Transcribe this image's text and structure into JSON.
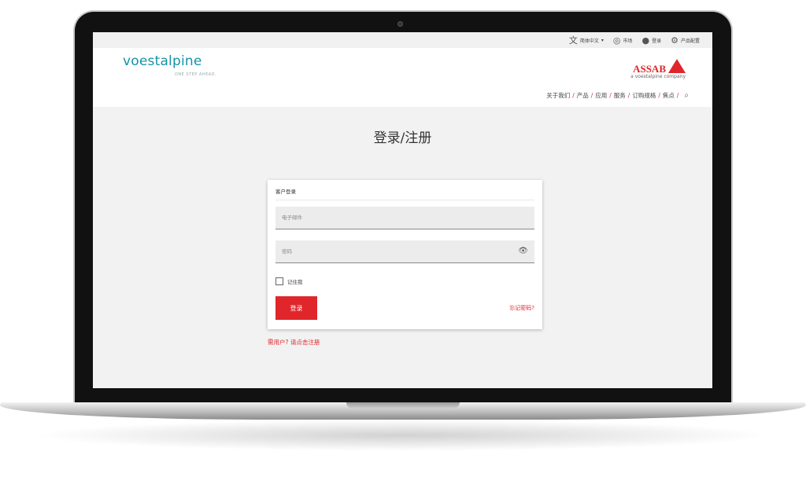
{
  "topbar": {
    "language": "简体中文",
    "market": "市场",
    "login": "登录",
    "configurator": "产品配置"
  },
  "brand": {
    "logo": "voestalpine",
    "tagline": "ONE STEP AHEAD.",
    "assab": "ASSAB",
    "assab_sub": "a voestalpine company"
  },
  "nav": [
    "关于我们",
    "产品",
    "应用",
    "服务",
    "订购规格",
    "焦点"
  ],
  "page": {
    "title": "登录/注册"
  },
  "form": {
    "title": "客户登录",
    "email_placeholder": "电子邮件",
    "password_placeholder": "密码",
    "remember": "记住我",
    "login_button": "登录",
    "forgot": "忘记密码?",
    "register": "需用户? 请点击注册"
  },
  "colors": {
    "brand_red": "#e0262b",
    "brand_teal": "#1493a8"
  }
}
